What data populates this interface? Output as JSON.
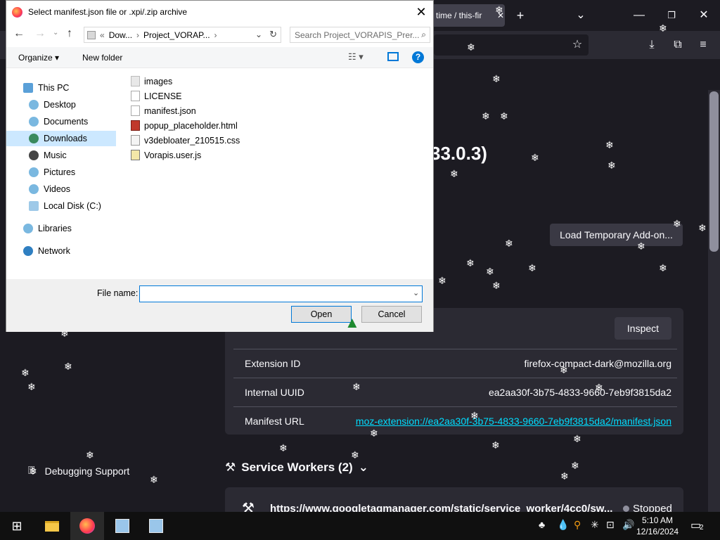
{
  "dialog": {
    "title": "Select manifest.json file or .xpi/.zip archive",
    "breadcrumb": [
      "«",
      "Dow...",
      "Project_VORAP...",
      "›"
    ],
    "search_placeholder": "Search Project_VORAPIS_Prer...",
    "organize_label": "Organize ▾",
    "new_folder_label": "New folder",
    "nav_items": [
      {
        "label": "This PC"
      },
      {
        "label": "Desktop"
      },
      {
        "label": "Documents"
      },
      {
        "label": "Downloads"
      },
      {
        "label": "Music"
      },
      {
        "label": "Pictures"
      },
      {
        "label": "Videos"
      },
      {
        "label": "Local Disk (C:)"
      },
      {
        "label": "Libraries"
      },
      {
        "label": "Network"
      }
    ],
    "files": [
      {
        "name": "images"
      },
      {
        "name": "LICENSE"
      },
      {
        "name": "manifest.json"
      },
      {
        "name": "popup_placeholder.html"
      },
      {
        "name": "v3debloater_210515.css"
      },
      {
        "name": "Vorapis.user.js"
      }
    ],
    "file_name_label": "File name:",
    "file_name_value": "",
    "open_label": "Open",
    "cancel_label": "Cancel"
  },
  "browser": {
    "tab_title": "time / this-fir",
    "version_text": "33.0.3)",
    "load_temp_label": "Load Temporary Add-on...",
    "inspect_label": "Inspect",
    "extension": {
      "id_label": "Extension ID",
      "id_value": "firefox-compact-dark@mozilla.org",
      "uuid_label": "Internal UUID",
      "uuid_value": "ea2aa30f-3b75-4833-9660-7eb9f3815da2",
      "manifest_label": "Manifest URL",
      "manifest_value": "moz-extension://ea2aa30f-3b75-4833-9660-7eb9f3815da2/manifest.json"
    },
    "service_workers_heading": "Service Workers (2)",
    "sw_url": "https://www.googletagmanager.com/static/service_worker/4cc0/sw...",
    "sw_status": "Stopped",
    "debugging_support": "Debugging Support"
  },
  "taskbar": {
    "time": "5:10 AM",
    "date": "12/16/2024",
    "notification_count": "2"
  }
}
